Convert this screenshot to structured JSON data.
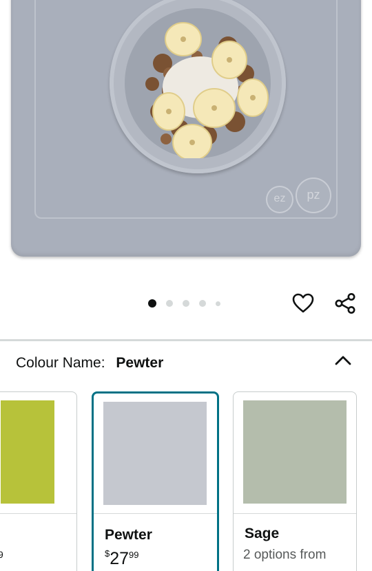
{
  "product_image": {
    "alt": "ezpz silicone placemat with bowl of granola, yogurt and banana",
    "logo_marks": [
      "ez",
      "pz"
    ]
  },
  "carousel": {
    "total": 5,
    "active_index": 0
  },
  "actions": {
    "favorite_icon": "heart-icon",
    "share_icon": "share-icon"
  },
  "variation": {
    "label": "Colour Name:",
    "value": "Pewter",
    "toggle_icon": "chevron-up-icon"
  },
  "swatches": [
    {
      "name": "",
      "color": "#b7c23a",
      "partial_text": "9"
    },
    {
      "name": "Pewter",
      "color": "#c5c8cf",
      "price_symbol": "$",
      "price_whole": "27",
      "price_fraction": "99",
      "selected": true
    },
    {
      "name": "Sage",
      "color": "#b4bdac",
      "subtext": "2 options from"
    }
  ],
  "colors": {
    "accent": "#007185",
    "text": "#0f1111",
    "muted": "#565959",
    "divider": "#d5d9d9"
  }
}
